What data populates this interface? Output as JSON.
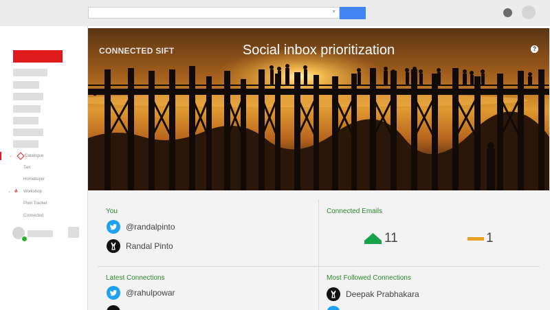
{
  "toolbar": {
    "search_placeholder": "",
    "search_button_color": "#4285f4"
  },
  "sidebar": {
    "logo_color": "#e01b1b",
    "tree": [
      {
        "label": "Catalogue",
        "icon": "diamond-icon",
        "children": [
          "Taxi",
          "Homebuyer"
        ]
      },
      {
        "label": "Workshop",
        "icon": "code-icon",
        "children": [
          "Pixel Tracker",
          "Connected"
        ]
      }
    ]
  },
  "hero": {
    "brand": "CONNECTED SIFT",
    "title": "Social inbox prioritization",
    "help_glyph": "?"
  },
  "cards": {
    "you": {
      "title": "You",
      "rows": [
        {
          "icon": "twitter-icon",
          "text": "@randalpinto"
        },
        {
          "icon": "avatar-icon",
          "text": "Randal Pinto"
        }
      ]
    },
    "connected_emails": {
      "title": "Connected Emails",
      "up_count": "11",
      "flat_count": "1",
      "up_color": "#17a34a",
      "flat_color": "#e6a020"
    },
    "latest_connections": {
      "title": "Latest Connections",
      "rows": [
        {
          "icon": "twitter-icon",
          "text": "@rahulpowar"
        }
      ]
    },
    "most_followed": {
      "title": "Most Followed Connections",
      "rows": [
        {
          "icon": "avatar-icon",
          "text": "Deepak Prabhakara"
        }
      ]
    }
  }
}
